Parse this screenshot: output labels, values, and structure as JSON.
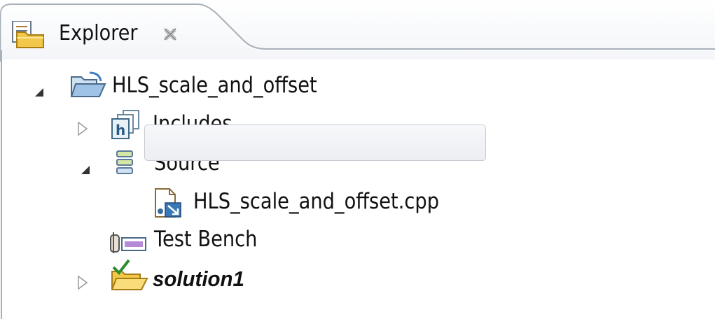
{
  "panel": {
    "tab_label": "Explorer",
    "tab_icon": "explorer-folder-icon",
    "close_icon": "close-icon"
  },
  "tree": {
    "project": {
      "label": "HLS_scale_and_offset",
      "expanded": true,
      "icon": "project-folder-icon"
    },
    "includes": {
      "label": "Includes",
      "expanded": false,
      "icon": "includes-header-icon"
    },
    "source": {
      "label": "Source",
      "expanded": true,
      "icon": "source-stack-icon"
    },
    "source_file": {
      "label": "HLS_scale_and_offset.cpp",
      "selected": true,
      "icon": "cpp-file-icon"
    },
    "test_bench": {
      "label": "Test Bench",
      "icon": "test-bench-icon"
    },
    "solution": {
      "label": "solution1",
      "expanded": false,
      "icon": "solution-folder-check-icon"
    }
  },
  "colors": {
    "border": "#a8b0ba",
    "selection_border": "#c6cbd1",
    "folder_yellow": "#f3c84a",
    "check_green": "#2e8b2e"
  }
}
